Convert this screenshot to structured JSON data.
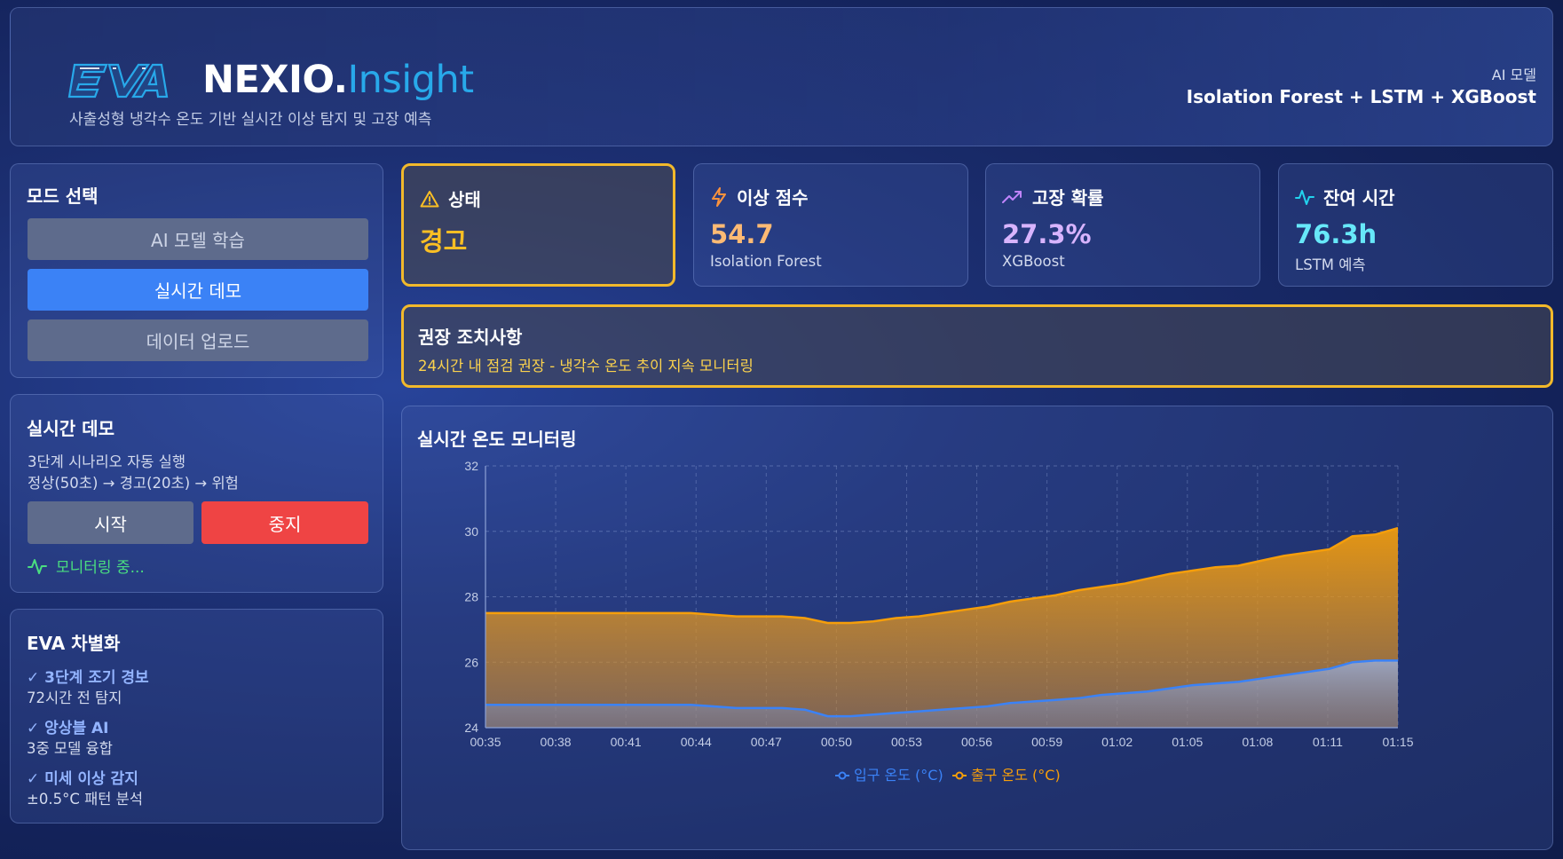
{
  "header": {
    "logo_text": "EVA",
    "brand_main": "NEXIO.",
    "brand_accent": "Insight",
    "subtitle": "사출성형 냉각수 온도 기반 실시간 이상 탐지 및 고장 예측",
    "model_label": "AI 모델",
    "model_value": "Isolation Forest + LSTM + XGBoost"
  },
  "mode_panel": {
    "title": "모드 선택",
    "buttons": [
      "AI 모델 학습",
      "실시간 데모",
      "데이터 업로드"
    ],
    "active_index": 1
  },
  "demo_panel": {
    "title": "실시간 데모",
    "line1": "3단계 시나리오 자동 실행",
    "line2": "정상(50초) → 경고(20초) → 위험",
    "start_label": "시작",
    "stop_label": "중지",
    "status_text": "모니터링 중..."
  },
  "diff_panel": {
    "title": "EVA 차별화",
    "items": [
      {
        "title": "✓ 3단계 조기 경보",
        "desc": "72시간 전 탐지"
      },
      {
        "title": "✓ 앙상블 AI",
        "desc": "3중 모델 융합"
      },
      {
        "title": "✓ 미세 이상 감지",
        "desc": "±0.5°C 패턴 분석"
      }
    ]
  },
  "cards": {
    "status": {
      "label": "상태",
      "value": "경고",
      "color": "#fbbf24"
    },
    "anomaly": {
      "label": "이상 점수",
      "value": "54.7",
      "sub": "Isolation Forest",
      "color": "#fdba74"
    },
    "prob": {
      "label": "고장 확률",
      "value": "27.3%",
      "sub": "XGBoost",
      "color": "#d8b4fe"
    },
    "remain": {
      "label": "잔여 시간",
      "value": "76.3h",
      "sub": "LSTM 예측",
      "color": "#67e8f9"
    }
  },
  "recommendation": {
    "title": "권장 조치사항",
    "text": "24시간 내 점검 권장 - 냉각수 온도 추이 지속 모니터링"
  },
  "chart_title": "실시간 온도 모니터링",
  "chart_data": {
    "type": "area",
    "title": "실시간 온도 모니터링",
    "xlabel": "",
    "ylabel": "",
    "ylim": [
      24,
      32
    ],
    "yticks": [
      24,
      26,
      28,
      30,
      32
    ],
    "x_ticks": [
      "00:35",
      "00:38",
      "00:41",
      "00:44",
      "00:47",
      "00:50",
      "00:53",
      "00:56",
      "00:59",
      "01:02",
      "01:05",
      "01:08",
      "01:11",
      "01:15"
    ],
    "x_minutes": [
      0,
      1,
      2,
      3,
      4,
      5,
      6,
      7,
      8,
      9,
      10,
      11,
      12,
      13,
      14,
      15,
      16,
      17,
      18,
      19,
      20,
      21,
      22,
      23,
      24,
      25,
      26,
      27,
      28,
      29,
      30,
      31,
      32,
      33,
      34,
      35,
      36,
      37,
      38,
      39,
      40
    ],
    "grid": true,
    "legend_position": "bottom",
    "series": [
      {
        "name": "입구 온도 (°C)",
        "color": "#3b82f6",
        "values": [
          24.7,
          24.7,
          24.7,
          24.7,
          24.7,
          24.7,
          24.7,
          24.7,
          24.7,
          24.7,
          24.65,
          24.6,
          24.6,
          24.6,
          24.55,
          24.35,
          24.35,
          24.4,
          24.45,
          24.5,
          24.55,
          24.6,
          24.65,
          24.75,
          24.8,
          24.85,
          24.9,
          25.0,
          25.05,
          25.1,
          25.2,
          25.3,
          25.35,
          25.4,
          25.5,
          25.6,
          25.7,
          25.8,
          26.0,
          26.05,
          26.05
        ]
      },
      {
        "name": "출구 온도 (°C)",
        "color": "#f59e0b",
        "values": [
          27.5,
          27.5,
          27.5,
          27.5,
          27.5,
          27.5,
          27.5,
          27.5,
          27.5,
          27.5,
          27.45,
          27.4,
          27.4,
          27.4,
          27.35,
          27.2,
          27.2,
          27.25,
          27.35,
          27.4,
          27.5,
          27.6,
          27.7,
          27.85,
          27.95,
          28.05,
          28.2,
          28.3,
          28.4,
          28.55,
          28.7,
          28.8,
          28.9,
          28.95,
          29.1,
          29.25,
          29.35,
          29.45,
          29.85,
          29.9,
          30.1
        ]
      }
    ]
  },
  "colors": {
    "accent": "#3b82f6",
    "warning": "#f2b92b",
    "danger": "#ef4444",
    "success": "#4ade80"
  }
}
